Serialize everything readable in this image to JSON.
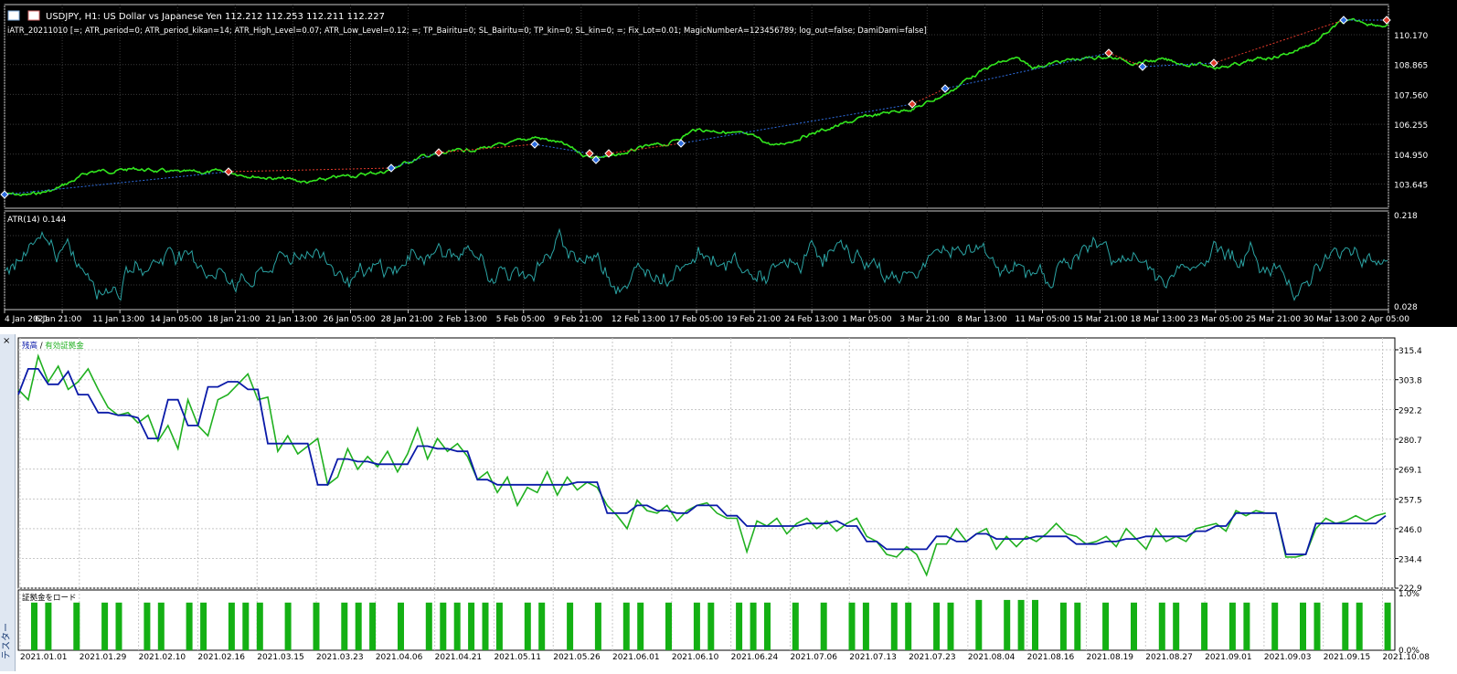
{
  "window": {
    "title": "USDJPY, H1:  US Dollar vs Japanese Yen  112.212 112.253 112.211 112.227",
    "ea_line": "iATR_20211010 [=; ATR_period=0; ATR_period_kikan=14; ATR_High_Level=0.07; ATR_Low_Level=0.12; =; TP_Bairitu=0; SL_Bairitu=0; TP_kin=0; SL_kin=0; =; Fix_Lot=0.01; MagicNumberA=123456789; log_out=false; DamiDami=false]"
  },
  "price_chart": {
    "price_ticks": [
      "110.170",
      "108.865",
      "107.560",
      "106.255",
      "104.950",
      "103.645"
    ],
    "time_labels": [
      "4 Jan 2021",
      "6 Jan 21:00",
      "11 Jan 13:00",
      "14 Jan 05:00",
      "18 Jan 21:00",
      "21 Jan 13:00",
      "26 Jan 05:00",
      "28 Jan 21:00",
      "2 Feb 13:00",
      "5 Feb 05:00",
      "9 Feb 21:00",
      "12 Feb 13:00",
      "17 Feb 05:00",
      "19 Feb 21:00",
      "24 Feb 13:00",
      "1 Mar 05:00",
      "3 Mar 21:00",
      "8 Mar 13:00",
      "11 Mar 05:00",
      "15 Mar 21:00",
      "18 Mar 13:00",
      "23 Mar 05:00",
      "25 Mar 21:00",
      "30 Mar 13:00",
      "2 Apr 05:00"
    ],
    "colors": {
      "price_line": "#32e61e",
      "buy_marker": "#2e6de0",
      "sell_marker": "#e0392a",
      "atr_line": "#2aa3a3",
      "grid": "#3a3a3a"
    }
  },
  "atr_chart": {
    "label": "ATR(14) 0.144",
    "ticks": [
      "0.218",
      "0.028"
    ]
  },
  "tester": {
    "close_glyph": "×",
    "side_tab": "テスター",
    "legend_balance": "残高",
    "legend_sep": " / ",
    "legend_equity": "有効証拠金",
    "margin_label": "証拠金をロード",
    "chart_data": [
      {
        "type": "line",
        "series": [
          {
            "name": "残高",
            "color": "#0a1aa8",
            "values": [
              298,
              308,
              308,
              302,
              302,
              307,
              298,
              298,
              291,
              291,
              290,
              290,
              289,
              281,
              281,
              296,
              296,
              286,
              286,
              301,
              301,
              303,
              303,
              300,
              300,
              279,
              279,
              279,
              279,
              279,
              263,
              263,
              273,
              273,
              272,
              272,
              271,
              271,
              271,
              271,
              278,
              278,
              277,
              277,
              276,
              276,
              265,
              265,
              263,
              263,
              263,
              263,
              263,
              263,
              263,
              263,
              264,
              264,
              264,
              252,
              252,
              252,
              255,
              255,
              253,
              253,
              252,
              252,
              255,
              255,
              255,
              251,
              251,
              247,
              247,
              247,
              247,
              247,
              247,
              248,
              248,
              248,
              249,
              247,
              247,
              241,
              241,
              238,
              238,
              238,
              238,
              238,
              243,
              243,
              241,
              241,
              244,
              244,
              242,
              242,
              242,
              242,
              243,
              243,
              243,
              243,
              240,
              240,
              240,
              241,
              241,
              242,
              242,
              243,
              243,
              243,
              243,
              243,
              245,
              245,
              247,
              247,
              252,
              252,
              252,
              252,
              252,
              236,
              236,
              236,
              248,
              248,
              248,
              248,
              248,
              248,
              248,
              251
            ]
          },
          {
            "name": "有効証拠金",
            "color": "#20b020",
            "values": [
              300,
              296,
              313,
              303,
              309,
              300,
              303,
              308,
              300,
              293,
              290,
              291,
              287,
              290,
              280,
              286,
              277,
              296,
              286,
              282,
              296,
              298,
              302,
              306,
              296,
              297,
              276,
              282,
              275,
              278,
              281,
              263,
              266,
              277,
              269,
              274,
              270,
              276,
              268,
              275,
              285,
              273,
              281,
              276,
              279,
              274,
              265,
              268,
              260,
              266,
              255,
              262,
              260,
              268,
              259,
              266,
              261,
              264,
              262,
              255,
              251,
              246,
              257,
              253,
              252,
              255,
              249,
              253,
              255,
              256,
              252,
              250,
              250,
              237,
              249,
              247,
              250,
              244,
              248,
              250,
              246,
              249,
              245,
              248,
              250,
              243,
              241,
              236,
              235,
              239,
              236,
              228,
              240,
              240,
              246,
              241,
              244,
              246,
              238,
              243,
              239,
              243,
              241,
              244,
              248,
              244,
              243,
              240,
              241,
              243,
              239,
              246,
              242,
              238,
              246,
              241,
              243,
              241,
              246,
              247,
              248,
              245,
              253,
              251,
              253,
              252,
              252,
              235,
              235,
              236,
              246,
              250,
              248,
              249,
              251,
              249,
              251,
              252
            ]
          }
        ],
        "x_labels": [
          "2021.01.01",
          "2021.01.29",
          "2021.02.10",
          "2021.02.16",
          "2021.03.15",
          "2021.03.23",
          "2021.04.06",
          "2021.04.21",
          "2021.05.11",
          "2021.05.26",
          "2021.06.01",
          "2021.06.10",
          "2021.06.24",
          "2021.07.06",
          "2021.07.13",
          "2021.07.23",
          "2021.08.04",
          "2021.08.16",
          "2021.08.19",
          "2021.08.27",
          "2021.09.01",
          "2021.09.03",
          "2021.09.15",
          "2021.10.08"
        ],
        "y_ticks": [
          "315.4",
          "303.8",
          "292.2",
          "280.7",
          "269.1",
          "257.5",
          "246.0",
          "234.4",
          "222.9"
        ],
        "ylim": [
          222.9,
          320
        ]
      },
      {
        "type": "bar",
        "values": [
          0.9,
          0.9,
          0,
          0.9,
          0,
          0.9,
          0.9,
          0,
          0.9,
          0.9,
          0,
          0.9,
          0.9,
          0,
          0.9,
          0.9,
          0.9,
          0,
          0.9,
          0,
          0.9,
          0,
          0.9,
          0.9,
          0.9,
          0,
          0.9,
          0,
          0.9,
          0.9,
          0.9,
          0.9,
          0.9,
          0.9,
          0,
          0.9,
          0.9,
          0,
          0.9,
          0,
          0.9,
          0,
          0.9,
          0.9,
          0,
          0.9,
          0,
          0.9,
          0.9,
          0,
          0.9,
          0.9,
          0.9,
          0,
          0.9,
          0,
          0.9,
          0,
          0.9,
          0.9,
          0,
          0.9,
          0.9,
          0,
          0.9,
          0.9,
          0,
          0.95,
          0,
          0.95,
          0.95,
          0.95,
          0,
          0.9,
          0.9,
          0,
          0.9,
          0,
          0.9,
          0,
          0.9,
          0.9,
          0,
          0.9,
          0,
          0.9,
          0.9,
          0,
          0.9,
          0,
          0.9,
          0.9,
          0,
          0.9,
          0.9,
          0,
          0.9
        ],
        "y_ticks": [
          "1.0%",
          "0.0%"
        ],
        "ylim": [
          0,
          1
        ]
      }
    ]
  }
}
